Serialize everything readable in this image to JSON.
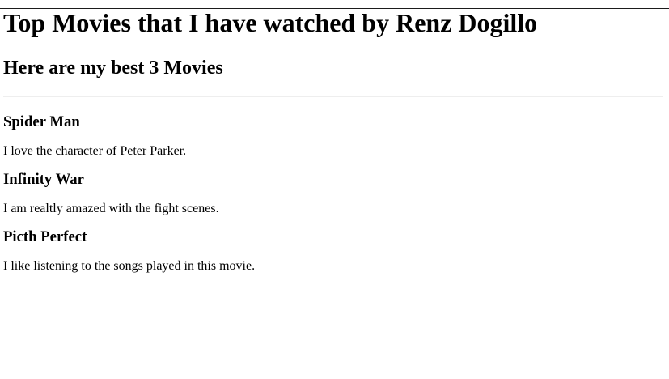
{
  "page": {
    "title": "Top Movies that I have watched by Renz Dogillo",
    "subtitle": "Here are my best 3 Movies"
  },
  "movies": [
    {
      "title": "Spider Man",
      "description": "I love the character of Peter Parker."
    },
    {
      "title": "Infinity War",
      "description": "I am realtly amazed with the fight scenes."
    },
    {
      "title": "Picth Perfect",
      "description": "I like listening to the songs played in this movie."
    }
  ]
}
